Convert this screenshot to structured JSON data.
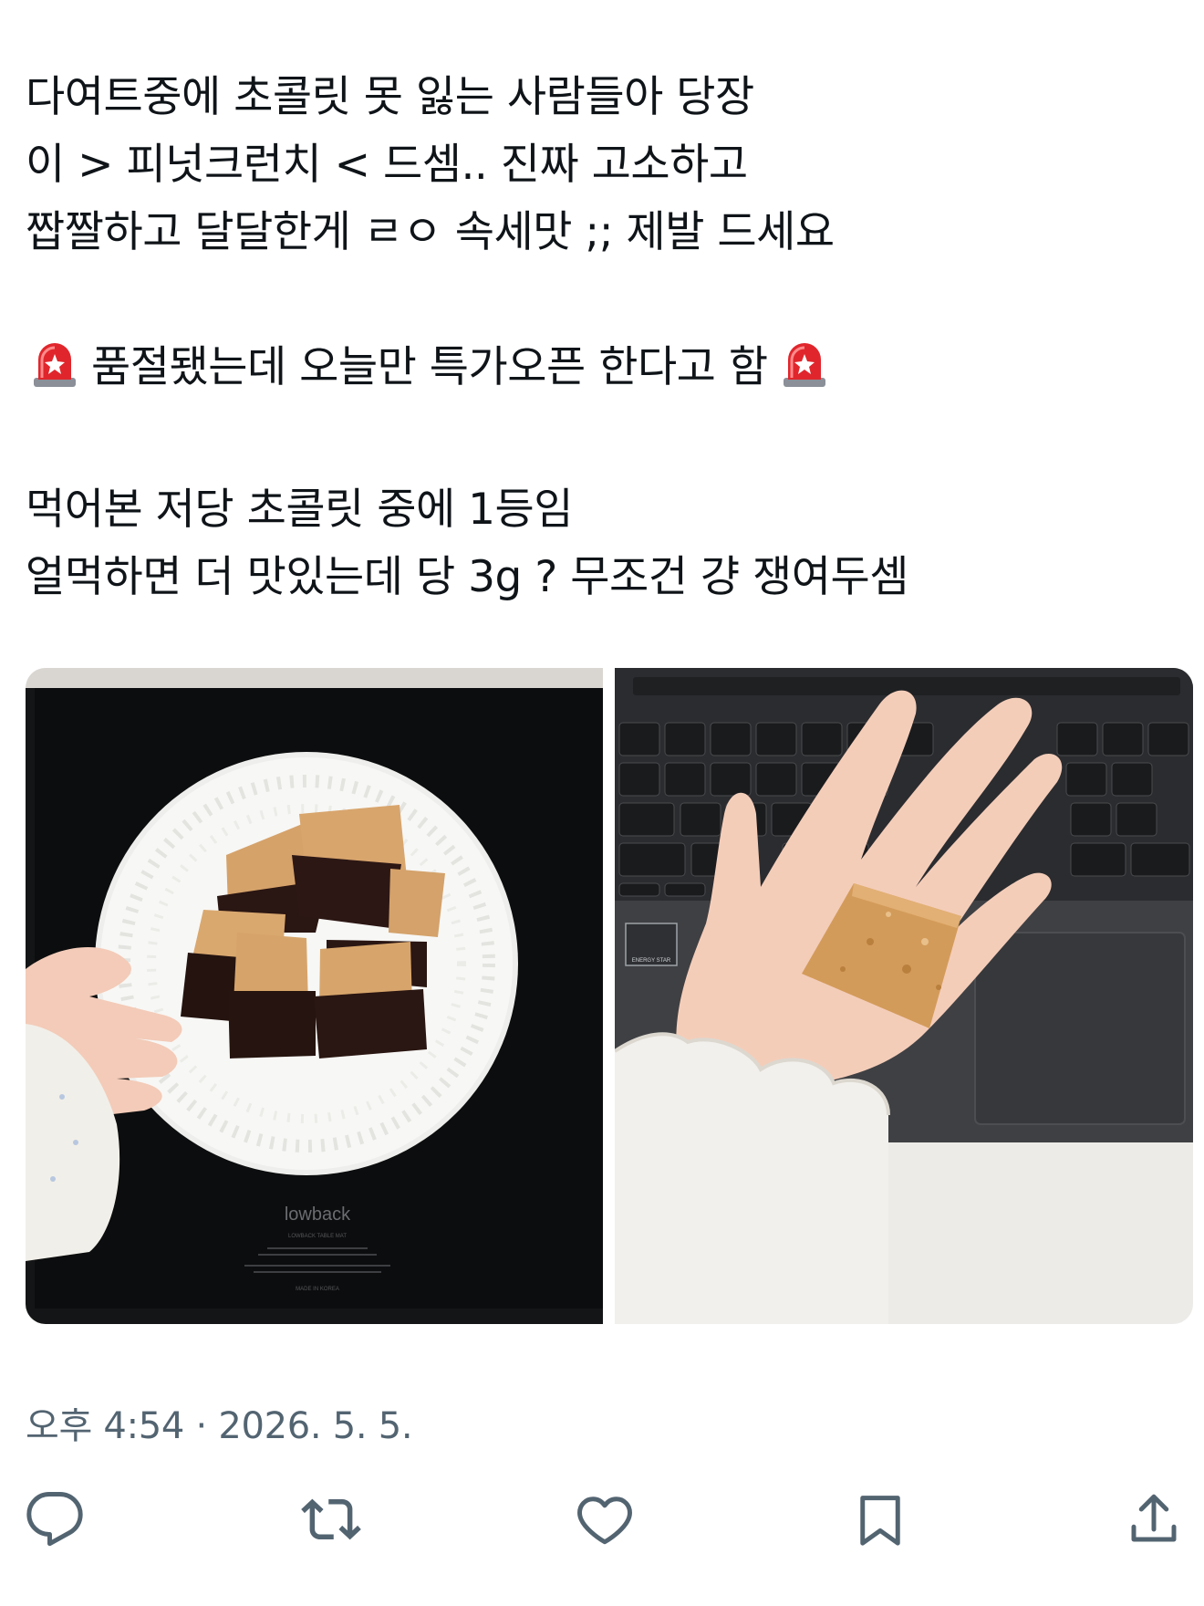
{
  "tweet": {
    "lines": [
      "다여트중에 초콜릿 못 잃는 사람들아 당장",
      "이 > 피넛크런치 < 드셈.. 진짜 고소하고",
      "짭짤하고 달달한게 ㄹㅇ 속세맛 ;; 제발 드세요",
      "품절됐는데 오늘만 특가오픈 한다고 함",
      "먹어본 저당 초콜릿 중에 1등임",
      "얼먹하면 더 맛있는데 당 3g ? 무조건 걍 쟁여두셈"
    ],
    "emoji_icon": "police-light-siren-icon"
  },
  "media": {
    "left_photo_caption": "lowback",
    "left_photo_subcaption": "LOWBACK TABLE MAT",
    "left_photo_madein": "MADE IN KOREA",
    "right_photo_label": "ENERGY STAR"
  },
  "meta": {
    "time": "오후 4:54",
    "separator": "·",
    "date": "2026. 5. 5."
  },
  "actions": {
    "icons": [
      "reply-icon",
      "retweet-icon",
      "like-icon",
      "bookmark-icon",
      "share-icon"
    ]
  },
  "colors": {
    "text": "#0f1419",
    "secondary": "#536471",
    "siren_red": "#e0262c"
  }
}
